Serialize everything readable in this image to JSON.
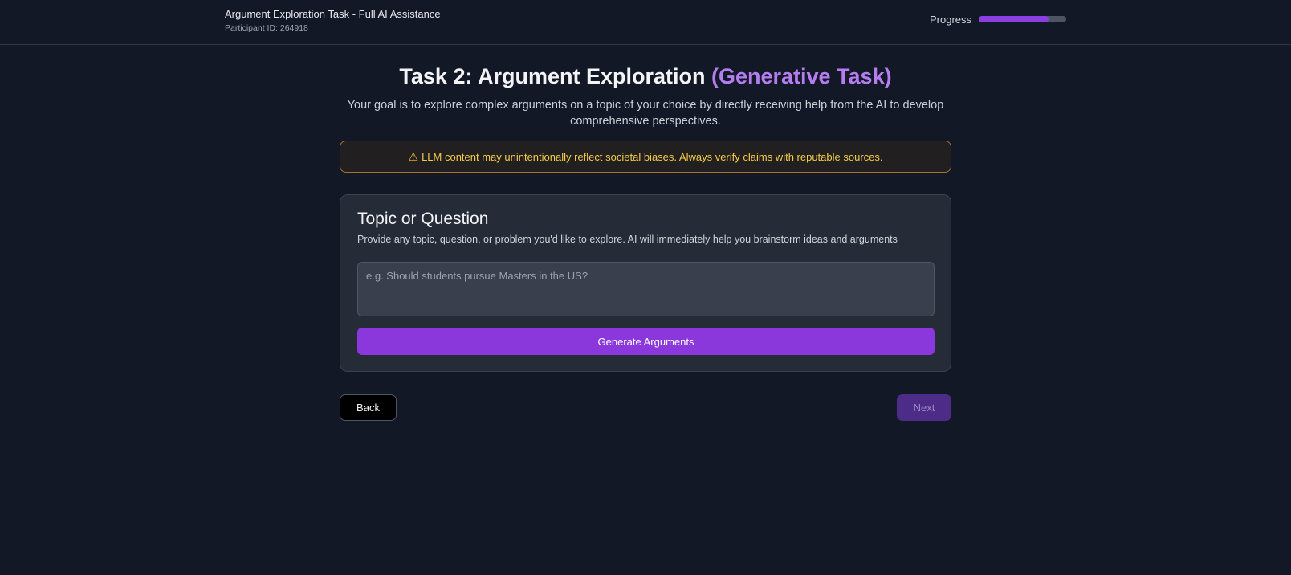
{
  "header": {
    "app_title": "Argument Exploration Task - Full AI Assistance",
    "participant": "Participant ID: 264918",
    "progress_label": "Progress",
    "progress_value": 0.8
  },
  "main": {
    "title_main": "Task 2: Argument Exploration",
    "title_accent": "(Generative Task)",
    "subtitle": "Your goal is to explore complex arguments on a topic of your choice by directly receiving help from the AI to develop comprehensive perspectives.",
    "warning_icon": "warning-triangle-icon",
    "warning_text": "LLM content may unintentionally reflect societal biases. Always verify claims with reputable sources."
  },
  "card": {
    "title": "Topic or Question",
    "description": "Provide any topic, question, or problem you'd like to explore. AI will immediately help you brainstorm ideas and arguments",
    "input_placeholder": "e.g. Should students pursue Masters in the US?",
    "input_value": "",
    "generate_label": "Generate Arguments"
  },
  "nav": {
    "back_label": "Back",
    "next_label": "Next",
    "next_disabled": true
  },
  "colors": {
    "background": "#121826",
    "accent": "#8a37db",
    "accent_text": "#b47ef0",
    "warning": "#f2cc4a"
  }
}
